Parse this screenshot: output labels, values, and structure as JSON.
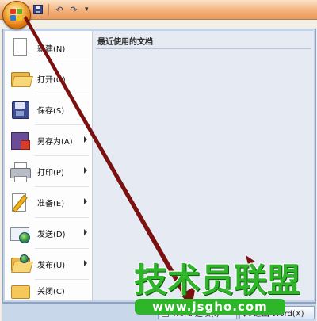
{
  "quick_access": {
    "icons": [
      "save-icon",
      "undo-icon",
      "redo-icon",
      "customize-dropdown-icon"
    ],
    "undo_glyph": "↶",
    "redo_glyph": "↷",
    "more_glyph": "▾"
  },
  "office_menu": {
    "recent_documents_title": "最近使用的文档",
    "items": [
      {
        "label": "新建(N)",
        "icon": "new-document-icon",
        "submenu": false
      },
      {
        "label": "打开(O)",
        "icon": "open-folder-icon",
        "submenu": false
      },
      {
        "label": "保存(S)",
        "icon": "save-disk-icon",
        "submenu": false
      },
      {
        "label": "另存为(A)",
        "icon": "save-as-icon",
        "submenu": true
      },
      {
        "label": "打印(P)",
        "icon": "printer-icon",
        "submenu": true
      },
      {
        "label": "准备(E)",
        "icon": "prepare-icon",
        "submenu": true
      },
      {
        "label": "发送(D)",
        "icon": "send-icon",
        "submenu": true
      },
      {
        "label": "发布(U)",
        "icon": "publish-icon",
        "submenu": true
      },
      {
        "label": "关闭(C)",
        "icon": "close-document-icon",
        "submenu": false
      }
    ],
    "bottom_buttons": {
      "options_label": "Word 选项(I)",
      "exit_label": "退出 Word(X)"
    }
  },
  "watermark": {
    "text": "技术员联盟",
    "url": "www.jsgho.com"
  },
  "colors": {
    "annotation_arrow": "#7a1010",
    "watermark_green": "#2fb52a"
  }
}
